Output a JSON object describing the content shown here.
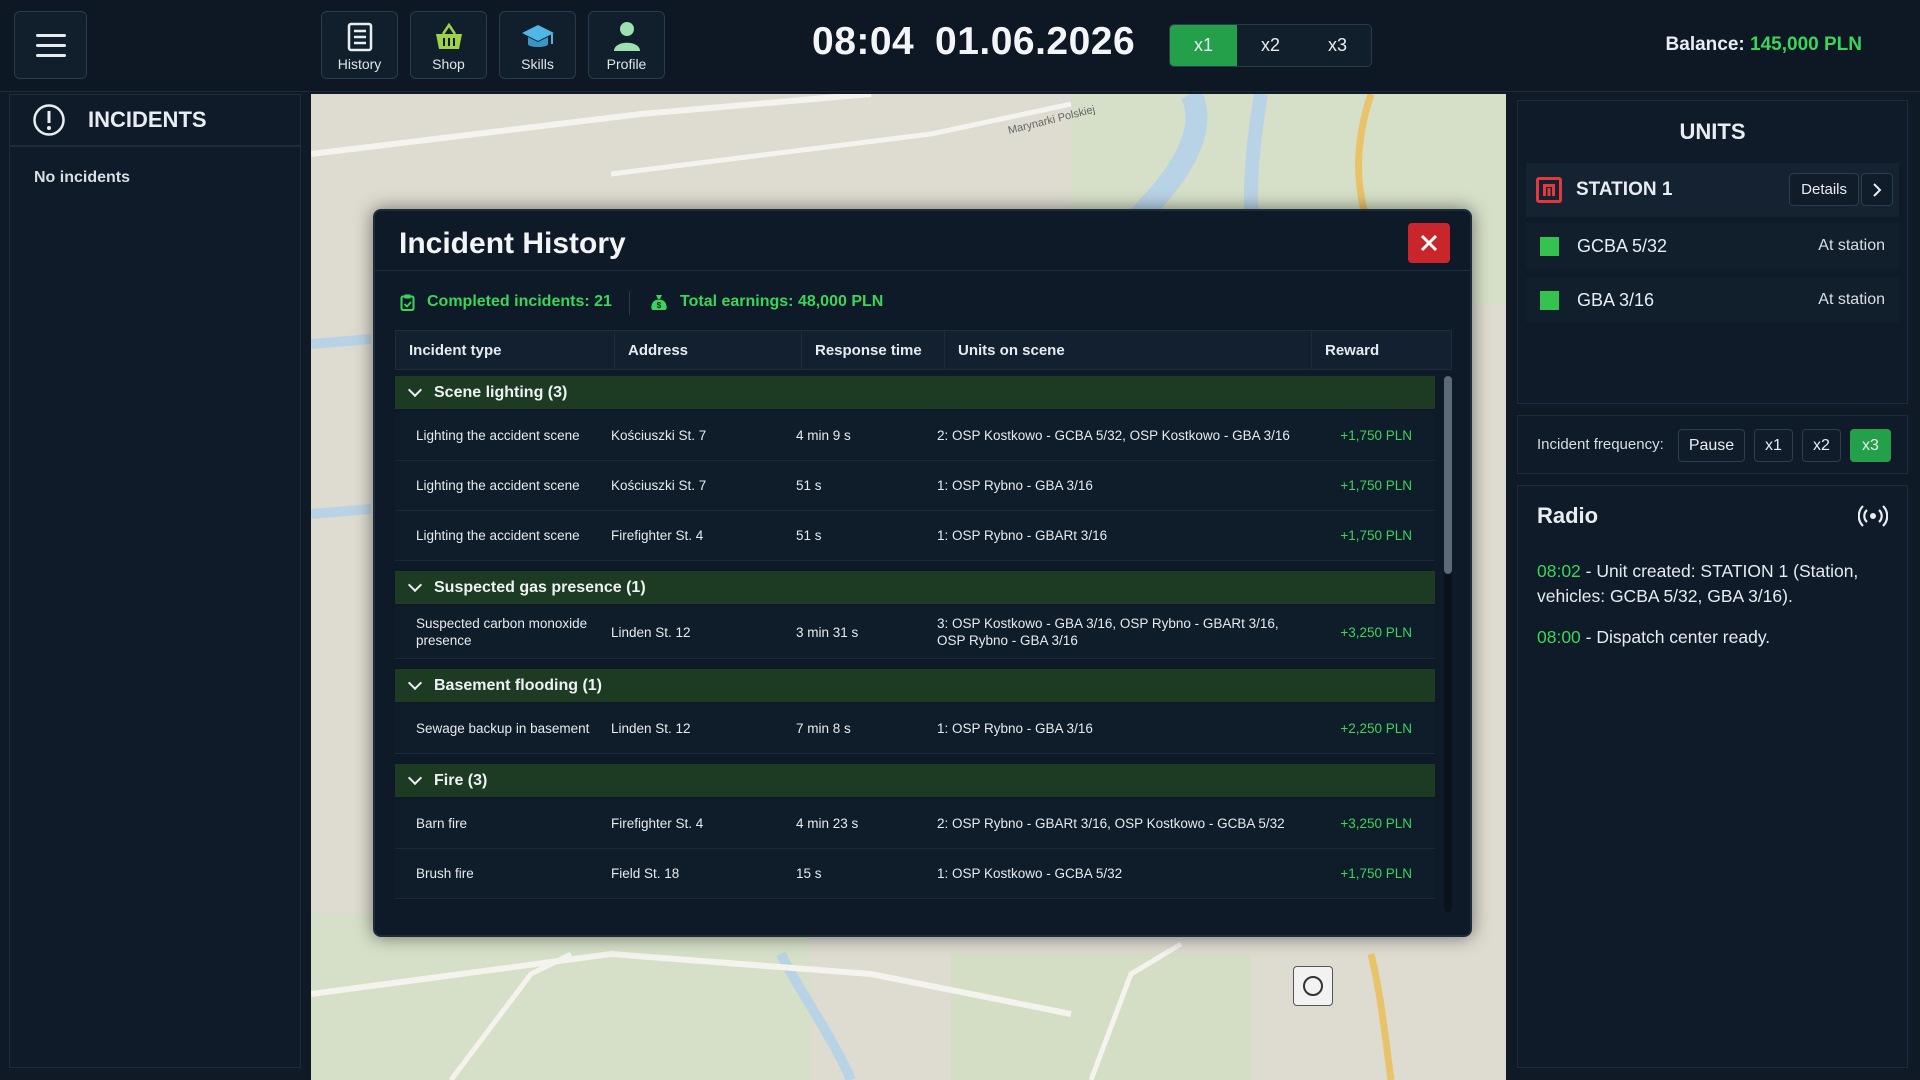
{
  "topbar": {
    "nav": [
      {
        "label": "History",
        "icon": "history-icon"
      },
      {
        "label": "Shop",
        "icon": "basket-icon"
      },
      {
        "label": "Skills",
        "icon": "graduation-cap-icon"
      },
      {
        "label": "Profile",
        "icon": "person-icon"
      }
    ],
    "time": "08:04",
    "date": "01.06.2026",
    "speeds": [
      {
        "label": "x1",
        "active": true
      },
      {
        "label": "x2",
        "active": false
      },
      {
        "label": "x3",
        "active": false
      }
    ],
    "balance_label": "Balance:",
    "balance_value": "145,000 PLN"
  },
  "incidents_panel": {
    "title": "INCIDENTS",
    "empty_text": "No incidents"
  },
  "map": {
    "street_label": "Marynarki Polskiej"
  },
  "modal": {
    "title": "Incident History",
    "completed": "Completed incidents: 21",
    "earnings": "Total earnings: 48,000 PLN",
    "columns": [
      "Incident type",
      "Address",
      "Response time",
      "Units on scene",
      "Reward"
    ],
    "groups": [
      {
        "label": "Scene lighting (3)",
        "rows": [
          {
            "type": "Lighting the accident scene",
            "address": "Kościuszki St. 7",
            "time": "4 min 9 s",
            "units": "2: OSP Kostkowo - GCBA 5/32, OSP Kostkowo - GBA 3/16",
            "reward": "+1,750 PLN"
          },
          {
            "type": "Lighting the accident scene",
            "address": "Kościuszki St. 7",
            "time": "51 s",
            "units": "1: OSP Rybno - GBA 3/16",
            "reward": "+1,750 PLN"
          },
          {
            "type": "Lighting the accident scene",
            "address": "Firefighter St. 4",
            "time": "51 s",
            "units": "1: OSP Rybno - GBARt 3/16",
            "reward": "+1,750 PLN"
          }
        ]
      },
      {
        "label": "Suspected gas presence (1)",
        "rows": [
          {
            "type": "Suspected carbon monoxide presence",
            "address": "Linden St. 12",
            "time": "3 min 31 s",
            "units": "3: OSP Kostkowo - GBA 3/16, OSP Rybno - GBARt 3/16, OSP Rybno - GBA 3/16",
            "reward": "+3,250 PLN"
          }
        ]
      },
      {
        "label": "Basement flooding (1)",
        "rows": [
          {
            "type": "Sewage backup in basement",
            "address": "Linden St. 12",
            "time": "7 min 8 s",
            "units": "1: OSP Rybno - GBA 3/16",
            "reward": "+2,250 PLN"
          }
        ]
      },
      {
        "label": "Fire (3)",
        "rows": [
          {
            "type": "Barn fire",
            "address": "Firefighter St. 4",
            "time": "4 min 23 s",
            "units": "2: OSP Rybno - GBARt 3/16, OSP Kostkowo - GCBA 5/32",
            "reward": "+3,250 PLN"
          },
          {
            "type": "Brush fire",
            "address": "Field St. 18",
            "time": "15 s",
            "units": "1: OSP Kostkowo - GCBA 5/32",
            "reward": "+1,750 PLN"
          }
        ]
      }
    ]
  },
  "units": {
    "title": "UNITS",
    "station": {
      "name": "STATION 1",
      "details_label": "Details"
    },
    "vehicles": [
      {
        "name": "GCBA 5/32",
        "status": "At station"
      },
      {
        "name": "GBA 3/16",
        "status": "At station"
      }
    ]
  },
  "frequency": {
    "label": "Incident frequency:",
    "options": [
      {
        "label": "Pause",
        "active": false
      },
      {
        "label": "x1",
        "active": false
      },
      {
        "label": "x2",
        "active": false
      },
      {
        "label": "x3",
        "active": true
      }
    ]
  },
  "radio": {
    "title": "Radio",
    "messages": [
      {
        "time": "08:02",
        "text": " - Unit created: STATION 1 (Station, vehicles: GCBA 5/32, GBA 3/16)."
      },
      {
        "time": "08:00",
        "text": " - Dispatch center ready."
      }
    ]
  },
  "colors": {
    "accent_green": "#39d65a",
    "active_button": "#25a04a",
    "close_red": "#c8262a",
    "group_header": "#1d3a22"
  }
}
